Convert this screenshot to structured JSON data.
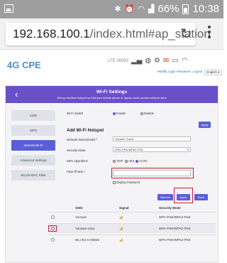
{
  "status_bar": {
    "battery_percent": "66%",
    "time": "10:38",
    "icons": [
      "gallery-icon",
      "bluetooth-icon",
      "alarm-icon",
      "wifi-icon",
      "signal-icon",
      "battery-icon"
    ]
  },
  "browser": {
    "url_host": "192.168.100.1",
    "url_rest": "/index.html#ap_station",
    "reload_icon": "reload-icon",
    "menu_icon": "kebab-menu-icon"
  },
  "header": {
    "logo": "4G CPE",
    "network": "LTE  36093",
    "modify_password": "Modify Login Password",
    "logout": "Logout",
    "language": "English ▾"
  },
  "banner": {
    "title": "Wi-Fi Settings",
    "subtitle": "Set up wireless hotspot so that your mobile phone or laptop could access network via it"
  },
  "sidebar": {
    "items": [
      {
        "label": "SSID"
      },
      {
        "label": "WPS"
      },
      {
        "label": "Internet Wi-Fi"
      },
      {
        "label": "Advanced Settings"
      },
      {
        "label": "WLAN MAC Filter"
      }
    ],
    "active_index": 2
  },
  "form": {
    "wifi_switch_label": "Wi-Fi Switch",
    "enable_label": "Enable",
    "disable_label": "Disable",
    "apply_top": "Apply",
    "section_title": "Add Wi-Fi Hotspot",
    "network_name_label": "Network Name(SSID) *",
    "network_name_value": "Vonsam Guest",
    "security_mode_label": "Security Mode",
    "security_mode_value": "WPA-PSK/WPA2-PSK",
    "wpa_algo_label": "WPA Algorithms",
    "tkip_label": "TKIP",
    "aes_label": "AES",
    "auto_label": "AUTO",
    "pass_phrase_label": "Pass Phrase *",
    "pass_phrase_value": "",
    "display_password_label": "Display Password",
    "refresh_label": "Refresh",
    "apply_label": "Apply",
    "back_label": "Back"
  },
  "table": {
    "headers": {
      "ssid": "SSID",
      "signal": "Signal",
      "security": "Security Mode"
    },
    "rows": [
      {
        "ssid": "Vonsam",
        "security": "WPA-PSK/WPA2-PSK",
        "selected": false
      },
      {
        "ssid": "Vonsam Gast",
        "security": "WPA-PSK/WPA2-PSK",
        "selected": true
      },
      {
        "ssid": "WLAN1-C7ZEE6",
        "security": "WPA-PSK/WPA2-PSK",
        "selected": false
      }
    ]
  },
  "colors": {
    "accent": "#5a5fd8",
    "banner": "#6a50c8",
    "highlight": "#d81b2a",
    "logo": "#4a90c8"
  }
}
